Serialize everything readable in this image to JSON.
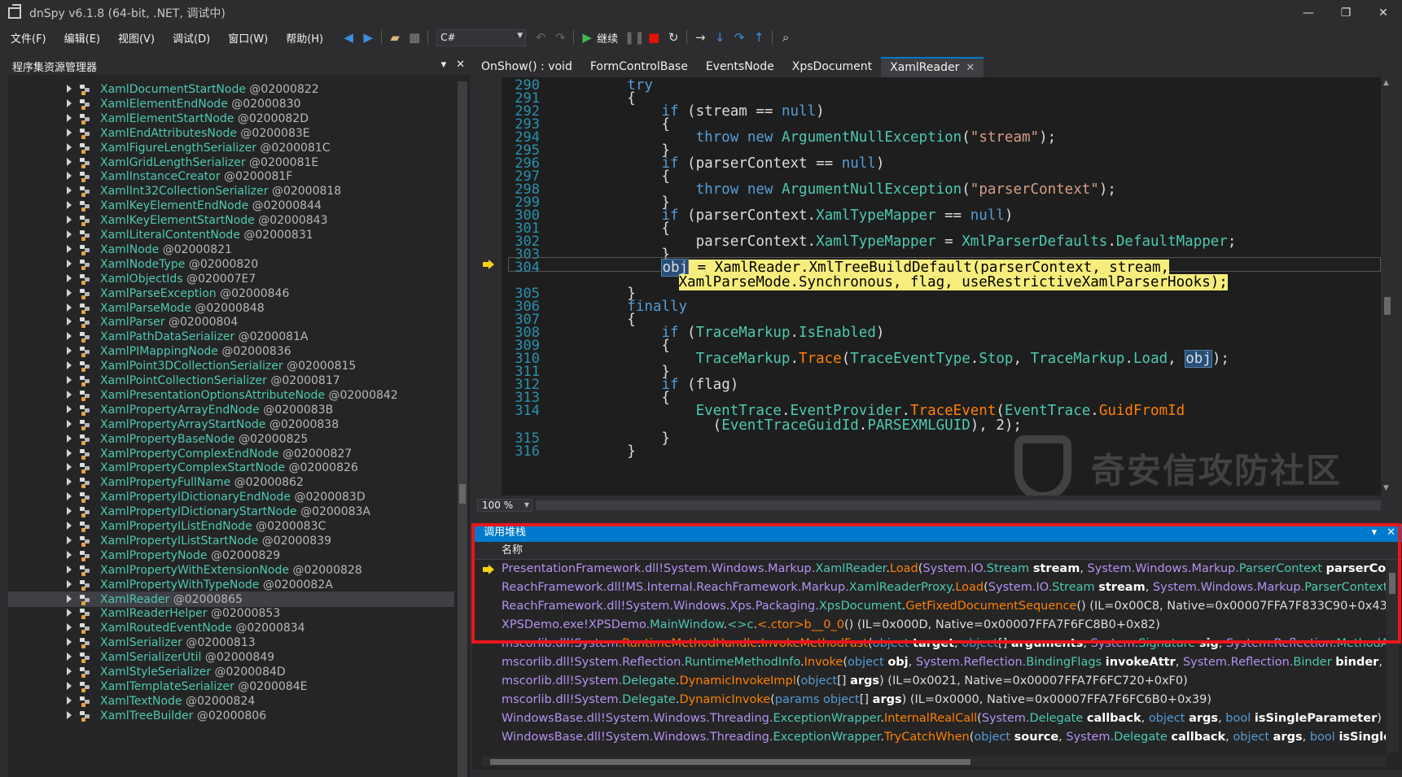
{
  "window": {
    "title": "dnSpy v6.1.8 (64-bit, .NET, 调试中)",
    "minimize": "—",
    "restore": "❐",
    "close": "✕"
  },
  "menu": [
    "文件(F)",
    "编辑(E)",
    "视图(V)",
    "调试(D)",
    "窗口(W)",
    "帮助(H)"
  ],
  "toolbar": {
    "language": "C#",
    "continue_label": "继续"
  },
  "assembly_explorer": {
    "title": "程序集资源管理器",
    "selected_index": 35,
    "items": [
      {
        "name": "XamlDocumentStartNode",
        "token": "@02000822"
      },
      {
        "name": "XamlElementEndNode",
        "token": "@02000830"
      },
      {
        "name": "XamlElementStartNode",
        "token": "@0200082D"
      },
      {
        "name": "XamlEndAttributesNode",
        "token": "@0200083E"
      },
      {
        "name": "XamlFigureLengthSerializer",
        "token": "@0200081C"
      },
      {
        "name": "XamlGridLengthSerializer",
        "token": "@0200081E"
      },
      {
        "name": "XamlInstanceCreator",
        "token": "@0200081F"
      },
      {
        "name": "XamlInt32CollectionSerializer",
        "token": "@02000818"
      },
      {
        "name": "XamlKeyElementEndNode",
        "token": "@02000844"
      },
      {
        "name": "XamlKeyElementStartNode",
        "token": "@02000843"
      },
      {
        "name": "XamlLiteralContentNode",
        "token": "@02000831"
      },
      {
        "name": "XamlNode",
        "token": "@02000821"
      },
      {
        "name": "XamlNodeType",
        "token": "@02000820"
      },
      {
        "name": "XamlObjectIds",
        "token": "@020007E7"
      },
      {
        "name": "XamlParseException",
        "token": "@02000846"
      },
      {
        "name": "XamlParseMode",
        "token": "@02000848"
      },
      {
        "name": "XamlParser",
        "token": "@02000804"
      },
      {
        "name": "XamlPathDataSerializer",
        "token": "@0200081A"
      },
      {
        "name": "XamlPIMappingNode",
        "token": "@02000836"
      },
      {
        "name": "XamlPoint3DCollectionSerializer",
        "token": "@02000815"
      },
      {
        "name": "XamlPointCollectionSerializer",
        "token": "@02000817"
      },
      {
        "name": "XamlPresentationOptionsAttributeNode",
        "token": "@02000842"
      },
      {
        "name": "XamlPropertyArrayEndNode",
        "token": "@0200083B"
      },
      {
        "name": "XamlPropertyArrayStartNode",
        "token": "@02000838"
      },
      {
        "name": "XamlPropertyBaseNode",
        "token": "@02000825"
      },
      {
        "name": "XamlPropertyComplexEndNode",
        "token": "@02000827"
      },
      {
        "name": "XamlPropertyComplexStartNode",
        "token": "@02000826"
      },
      {
        "name": "XamlPropertyFullName",
        "token": "@02000862"
      },
      {
        "name": "XamlPropertyIDictionaryEndNode",
        "token": "@0200083D"
      },
      {
        "name": "XamlPropertyIDictionaryStartNode",
        "token": "@0200083A"
      },
      {
        "name": "XamlPropertyIListEndNode",
        "token": "@0200083C"
      },
      {
        "name": "XamlPropertyIListStartNode",
        "token": "@02000839"
      },
      {
        "name": "XamlPropertyNode",
        "token": "@02000829"
      },
      {
        "name": "XamlPropertyWithExtensionNode",
        "token": "@02000828"
      },
      {
        "name": "XamlPropertyWithTypeNode",
        "token": "@0200082A"
      },
      {
        "name": "XamlReader",
        "token": "@02000865"
      },
      {
        "name": "XamlReaderHelper",
        "token": "@02000853"
      },
      {
        "name": "XamlRoutedEventNode",
        "token": "@02000834"
      },
      {
        "name": "XamlSerializer",
        "token": "@02000813"
      },
      {
        "name": "XamlSerializerUtil",
        "token": "@02000849"
      },
      {
        "name": "XamlStyleSerializer",
        "token": "@0200084D"
      },
      {
        "name": "XamlTemplateSerializer",
        "token": "@0200084E"
      },
      {
        "name": "XamlTextNode",
        "token": "@02000824"
      },
      {
        "name": "XamlTreeBuilder",
        "token": "@02000806"
      }
    ]
  },
  "tabs": [
    {
      "label": "OnShow() : void"
    },
    {
      "label": "FormControlBase"
    },
    {
      "label": "EventsNode"
    },
    {
      "label": "XpsDocument"
    },
    {
      "label": "XamlReader",
      "active": true
    }
  ],
  "editor": {
    "zoom": "100 %",
    "current_line": 304
  },
  "callstack": {
    "title": "调用堆栈",
    "column": "名称"
  }
}
